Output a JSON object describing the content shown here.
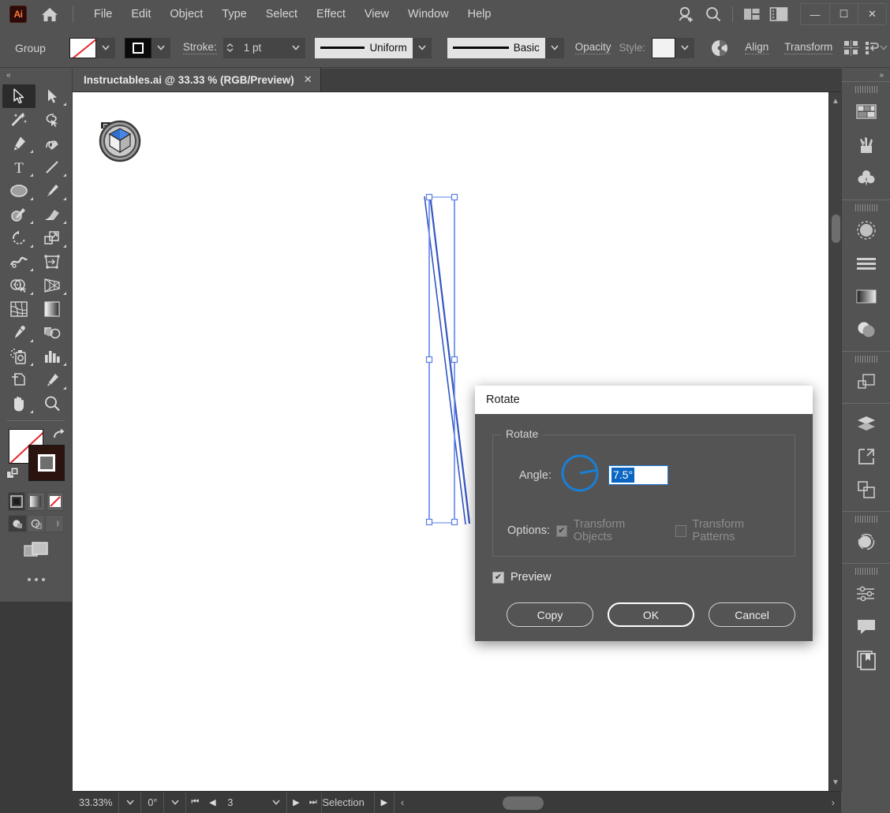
{
  "app": {
    "logo_text": "Ai",
    "home_icon": "home-icon"
  },
  "menubar": {
    "items": [
      "File",
      "Edit",
      "Object",
      "Type",
      "Select",
      "Effect",
      "View",
      "Window",
      "Help"
    ],
    "right_icons": [
      "add-user-icon",
      "search-icon",
      "workspace-switcher-icon",
      "panel-toggle-icon"
    ],
    "window_controls": [
      "minimize-icon",
      "maximize-icon",
      "close-icon"
    ]
  },
  "controlbar": {
    "selection_label": "Group",
    "fill_swatch": "none-swatch",
    "stroke_swatch": "black-swatch",
    "stroke_label": "Stroke:",
    "stroke_weight": "1 pt",
    "variable_width_profile": "Uniform",
    "brush_definition": "Basic",
    "opacity_label": "Opacity",
    "style_label": "Style:",
    "recolor_icon": "recolor-artwork-icon",
    "align_label": "Align",
    "transform_label": "Transform",
    "distribute_icon": "distribute-spacing-icon",
    "arrange_icon": "arrange-objects-icon",
    "more_icon": "options-list-icon"
  },
  "toolpanel": {
    "collapse_icon": "collapse-left-icon",
    "tools": [
      {
        "name": "selection-tool",
        "icon": "arrow-cursor-icon",
        "active": true,
        "has_flyout": false
      },
      {
        "name": "direct-selection-tool",
        "icon": "white-arrow-icon",
        "active": false,
        "has_flyout": true
      },
      {
        "name": "magic-wand-tool",
        "icon": "magic-wand-icon",
        "active": false,
        "has_flyout": false
      },
      {
        "name": "lasso-tool",
        "icon": "lasso-icon",
        "active": false,
        "has_flyout": false
      },
      {
        "name": "pen-tool",
        "icon": "pen-nib-icon",
        "active": false,
        "has_flyout": true
      },
      {
        "name": "curvature-tool",
        "icon": "curvature-pen-icon",
        "active": false,
        "has_flyout": false
      },
      {
        "name": "type-tool",
        "icon": "type-t-icon",
        "active": false,
        "has_flyout": true
      },
      {
        "name": "line-segment-tool",
        "icon": "diagonal-line-icon",
        "active": false,
        "has_flyout": true
      },
      {
        "name": "ellipse-tool",
        "icon": "ellipse-icon",
        "active": false,
        "has_flyout": true
      },
      {
        "name": "paintbrush-tool",
        "icon": "paintbrush-icon",
        "active": false,
        "has_flyout": true
      },
      {
        "name": "shaper-tool",
        "icon": "shaper-pencil-icon",
        "active": false,
        "has_flyout": true
      },
      {
        "name": "eraser-tool",
        "icon": "eraser-icon",
        "active": false,
        "has_flyout": true
      },
      {
        "name": "rotate-tool",
        "icon": "rotate-arrow-icon",
        "active": false,
        "has_flyout": true
      },
      {
        "name": "scale-tool",
        "icon": "scale-box-icon",
        "active": false,
        "has_flyout": true
      },
      {
        "name": "width-tool",
        "icon": "width-warp-icon",
        "active": false,
        "has_flyout": true
      },
      {
        "name": "free-transform-tool",
        "icon": "free-transform-icon",
        "active": false,
        "has_flyout": false
      },
      {
        "name": "shape-builder-tool",
        "icon": "shape-builder-icon",
        "active": false,
        "has_flyout": true
      },
      {
        "name": "perspective-grid-tool",
        "icon": "perspective-grid-icon",
        "active": false,
        "has_flyout": true
      },
      {
        "name": "mesh-tool",
        "icon": "mesh-icon",
        "active": false,
        "has_flyout": false
      },
      {
        "name": "gradient-tool",
        "icon": "gradient-icon",
        "active": false,
        "has_flyout": false
      },
      {
        "name": "eyedropper-tool",
        "icon": "eyedropper-icon",
        "active": false,
        "has_flyout": true
      },
      {
        "name": "blend-tool",
        "icon": "blend-shapes-icon",
        "active": false,
        "has_flyout": false
      },
      {
        "name": "symbol-sprayer-tool",
        "icon": "symbol-sprayer-icon",
        "active": false,
        "has_flyout": true
      },
      {
        "name": "column-graph-tool",
        "icon": "bar-chart-icon",
        "active": false,
        "has_flyout": true
      },
      {
        "name": "artboard-tool",
        "icon": "artboard-icon",
        "active": false,
        "has_flyout": false
      },
      {
        "name": "slice-tool",
        "icon": "slice-knife-icon",
        "active": false,
        "has_flyout": true
      },
      {
        "name": "hand-tool",
        "icon": "hand-icon",
        "active": false,
        "has_flyout": true
      },
      {
        "name": "zoom-tool",
        "icon": "magnifier-icon",
        "active": false,
        "has_flyout": false
      }
    ],
    "fill_stroke": {
      "fill": "none-swatch",
      "stroke": "black-square-swatch",
      "swap_icon": "swap-fill-stroke-icon",
      "default_icon": "default-fill-stroke-icon"
    },
    "color_modes": [
      {
        "name": "color-mode-button",
        "icon": "solid-color-icon",
        "selected": true
      },
      {
        "name": "gradient-mode-button",
        "icon": "gradient-ramp-icon",
        "selected": false
      },
      {
        "name": "none-mode-button",
        "icon": "none-slash-icon",
        "selected": false
      }
    ],
    "draw_modes": [
      {
        "name": "draw-normal-button",
        "icon": "draw-normal-icon",
        "selected": true
      },
      {
        "name": "draw-behind-button",
        "icon": "draw-behind-icon",
        "selected": false
      },
      {
        "name": "draw-inside-button",
        "icon": "draw-inside-icon",
        "selected": false
      }
    ],
    "screen_mode_icon": "change-screen-mode-icon",
    "edit_toolbar_icon": "edit-toolbar-dots-icon"
  },
  "document": {
    "tab_title": "Instructables.ai @ 33.33 % (RGB/Preview)",
    "close_icon": "close-tab-icon",
    "artboard_logo": "cube-logo-artwork",
    "selection_shape": "rotated-line-selection"
  },
  "rightdock": {
    "collapse_icon": "collapse-right-icon",
    "groups": [
      {
        "items": [
          {
            "name": "panel-color",
            "icon": "color-swatches-icon"
          },
          {
            "name": "panel-brushes",
            "icon": "brushes-icon"
          },
          {
            "name": "panel-symbols",
            "icon": "symbols-clover-icon"
          }
        ]
      },
      {
        "items": [
          {
            "name": "panel-stroke-dashed",
            "icon": "dashed-circle-icon"
          },
          {
            "name": "panel-stroke",
            "icon": "stroke-lines-icon"
          },
          {
            "name": "panel-gradient",
            "icon": "gradient-ramp-icon"
          },
          {
            "name": "panel-transparency",
            "icon": "transparency-circles-icon"
          }
        ]
      },
      {
        "items": [
          {
            "name": "panel-transform",
            "icon": "transform-squares-icon"
          }
        ]
      },
      {
        "items": [
          {
            "name": "panel-layers",
            "icon": "layers-stack-icon"
          },
          {
            "name": "panel-artboards",
            "icon": "artboard-export-icon"
          },
          {
            "name": "panel-asset-export",
            "icon": "asset-export-icon"
          }
        ]
      },
      {
        "items": [
          {
            "name": "panel-pathfinder",
            "icon": "pathfinder-circle-icon"
          }
        ]
      },
      {
        "items": [
          {
            "name": "panel-properties",
            "icon": "sliders-icon"
          },
          {
            "name": "panel-comments",
            "icon": "comment-bubble-icon"
          },
          {
            "name": "panel-libraries",
            "icon": "libraries-book-icon"
          }
        ]
      }
    ]
  },
  "statusbar": {
    "zoom_level": "33.33%",
    "rotation": "0°",
    "artboard_number": "3",
    "status_text": "Selection",
    "first_icon": "first-artboard-icon",
    "prev_icon": "prev-artboard-icon",
    "next_icon": "next-artboard-icon",
    "last_icon": "last-artboard-icon",
    "play_icon": "play-icon",
    "scroll_left_icon": "scroll-left-icon",
    "scroll_right_icon": "scroll-right-icon"
  },
  "dialog": {
    "title": "Rotate",
    "group_legend": "Rotate",
    "angle_label": "Angle:",
    "angle_value": "7.5°",
    "angle_dial_icon": "angle-dial-icon",
    "options_label": "Options:",
    "transform_objects_label": "Transform Objects",
    "transform_objects_checked": true,
    "transform_patterns_label": "Transform Patterns",
    "transform_patterns_checked": false,
    "preview_label": "Preview",
    "preview_checked": true,
    "buttons": [
      {
        "name": "copy-button",
        "label": "Copy",
        "default": false
      },
      {
        "name": "ok-button",
        "label": "OK",
        "default": true
      },
      {
        "name": "cancel-button",
        "label": "Cancel",
        "default": false
      }
    ],
    "check_glyph": "✔"
  },
  "colors": {
    "chrome": "#535353",
    "dialog_bg": "#545454",
    "accent_blue": "#0a66c2",
    "selection_blue": "#6a8ff0",
    "none_red": "#e4272b"
  }
}
